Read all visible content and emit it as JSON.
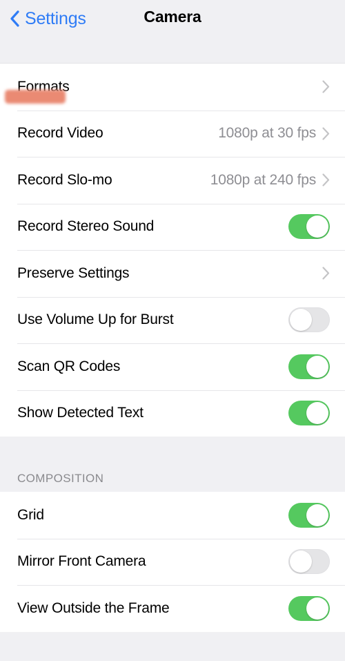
{
  "navbar": {
    "back_label": "Settings",
    "back_icon": "chevron-left-icon",
    "title": "Camera"
  },
  "colors": {
    "accent_blue": "#2F7CF6",
    "toggle_on_green": "#55C95F",
    "toggle_off_gray": "#E5E5E7",
    "value_gray": "#8E8E93",
    "section_header_gray": "#8A8A8E",
    "page_background": "#F0F0F3",
    "row_background": "#FFFFFF",
    "separator": "#E6E6E9",
    "chevron_gray": "#C4C4C6",
    "redaction_salmon": "#EA8A73"
  },
  "sections": [
    {
      "header": "",
      "rows": [
        {
          "label": "Formats",
          "type": "disclosure",
          "value": "",
          "redacted": true
        },
        {
          "label": "Record Video",
          "type": "disclosure",
          "value": "1080p at 30 fps"
        },
        {
          "label": "Record Slo-mo",
          "type": "disclosure",
          "value": "1080p at 240 fps"
        },
        {
          "label": "Record Stereo Sound",
          "type": "toggle",
          "toggle_state": "on"
        },
        {
          "label": "Preserve Settings",
          "type": "disclosure",
          "value": ""
        },
        {
          "label": "Use Volume Up for Burst",
          "type": "toggle",
          "toggle_state": "off"
        },
        {
          "label": "Scan QR Codes",
          "type": "toggle",
          "toggle_state": "on"
        },
        {
          "label": "Show Detected Text",
          "type": "toggle",
          "toggle_state": "on"
        }
      ]
    },
    {
      "header": "COMPOSITION",
      "rows": [
        {
          "label": "Grid",
          "type": "toggle",
          "toggle_state": "on"
        },
        {
          "label": "Mirror Front Camera",
          "type": "toggle",
          "toggle_state": "off"
        },
        {
          "label": "View Outside the Frame",
          "type": "toggle",
          "toggle_state": "on"
        }
      ]
    }
  ]
}
